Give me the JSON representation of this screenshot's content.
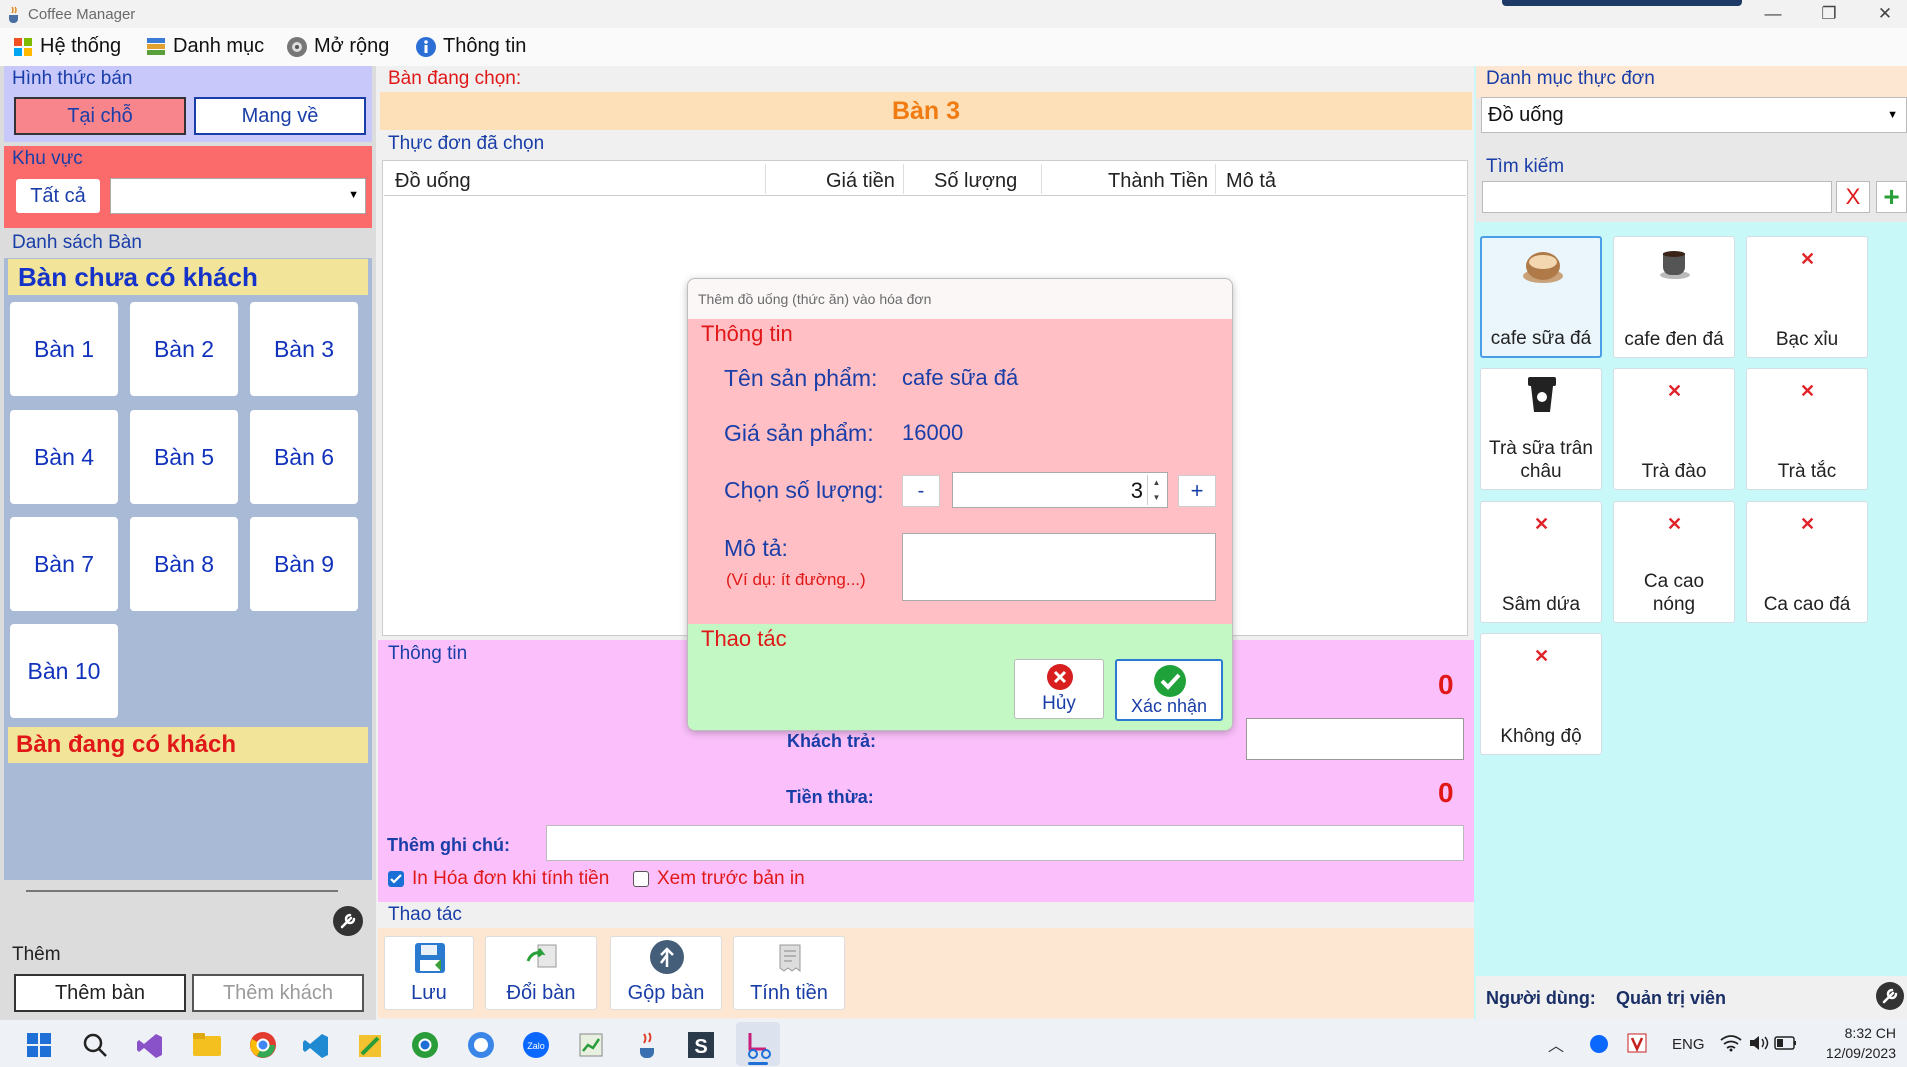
{
  "app": {
    "title": "Coffee Manager",
    "win_minimize": "—",
    "win_maximize": "❐",
    "win_close": "✕"
  },
  "menu": [
    {
      "label": "Hệ thống",
      "icon": "windows-logo-icon"
    },
    {
      "label": "Danh mục",
      "icon": "books-icon"
    },
    {
      "label": "Mở rộng",
      "icon": "gear-disc-icon"
    },
    {
      "label": "Thông tin",
      "icon": "info-icon"
    }
  ],
  "left": {
    "order_type": {
      "title": "Hình thức bán",
      "dine_in": "Tại chỗ",
      "takeaway": "Mang về"
    },
    "area": {
      "title": "Khu vực",
      "all_button": "Tất cả",
      "select_value": ""
    },
    "tables": {
      "title": "Danh sách Bàn",
      "empty_header": "Bàn chưa có khách",
      "occupied_header": "Bàn đang có khách",
      "empty_tables": [
        "Bàn 1",
        "Bàn 2",
        "Bàn 3",
        "Bàn 4",
        "Bàn 5",
        "Bàn 6",
        "Bàn 7",
        "Bàn 8",
        "Bàn 9",
        "Bàn 10"
      ]
    },
    "add": {
      "title": "Thêm",
      "add_table": "Thêm bàn",
      "add_customer": "Thêm khách"
    }
  },
  "center": {
    "selected_label": "Bàn đang chọn:",
    "selected_table": "Bàn 3",
    "menu_selected_label": "Thực đơn đã chọn",
    "columns": [
      "Đồ uống",
      "Giá tiền",
      "Số lượng",
      "Thành Tiền",
      "Mô tả"
    ],
    "info": {
      "title": "Thông tin",
      "total_value": "0",
      "customer_pay_label": "Khách trả:",
      "customer_pay_value": "",
      "change_label": "Tiền thừa:",
      "change_value": "0",
      "note_label": "Thêm ghi chú:",
      "note_value": "",
      "print_invoice": "In Hóa đơn khi tính tiền",
      "print_invoice_checked": true,
      "preview_print": "Xem trước bản in",
      "preview_print_checked": false
    },
    "actions": {
      "title": "Thao tác",
      "buttons": [
        "Lưu",
        "Đổi bàn",
        "Gộp bàn",
        "Tính tiền"
      ]
    }
  },
  "right": {
    "category_label": "Danh mục thực đơn",
    "category_value": "Đồ uống",
    "search_label": "Tìm kiếm",
    "search_value": "",
    "clear_label": "X",
    "add_label": "+",
    "items": [
      "cafe sữa đá",
      "cafe đen đá",
      "Bạc xỉu",
      "Trà sữa trân châu",
      "Trà đào",
      "Trà tắc",
      "Sâm dứa",
      "Ca cao nóng",
      "Ca cao đá",
      "Không độ"
    ],
    "user_label": "Người dùng:",
    "user_value": "Quản trị viên"
  },
  "dialog": {
    "title": "Thêm đồ uống (thức ăn) vào hóa đơn",
    "info_title": "Thông tin",
    "product_name_label": "Tên sản phẩm:",
    "product_name": "cafe sữa đá",
    "price_label": "Giá sản phẩm:",
    "price": "16000",
    "qty_label": "Chọn số lượng:",
    "qty_minus": "-",
    "qty_value": "3",
    "qty_plus": "+",
    "desc_label": "Mô tả:",
    "desc_hint": "(Ví dụ: ít đường...)",
    "desc_value": "",
    "actions_title": "Thao tác",
    "cancel": "Hủy",
    "confirm": "Xác nhận"
  },
  "taskbar": {
    "lang": "ENG",
    "time": "8:32 CH",
    "date": "12/09/2023"
  },
  "colors": {
    "pink_header": "#ffbfc4",
    "blue_panel": "#c8c8fb",
    "table_panel": "#a8bad6",
    "yellow_header": "#f2e59a",
    "info_panel": "#fbc0fb",
    "action_panel": "#fde7d3",
    "right_panel": "#c8f8f7",
    "dialog_green": "#c3f8c4",
    "accent_red": "#e01818",
    "accent_blue": "#1a3ea8"
  }
}
